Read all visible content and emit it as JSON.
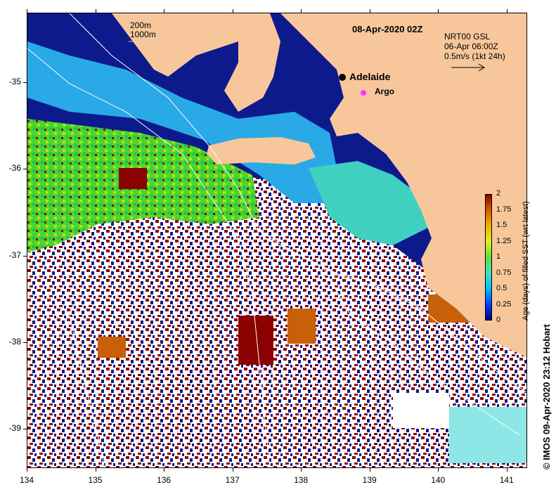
{
  "map": {
    "title": "08-Apr-2020 02Z",
    "depth_contours": [
      "200m",
      "1000m"
    ],
    "current_info": [
      "NRT00 GSL",
      "06-Apr 06:00Z",
      "0.5m/s (1kt 24h)"
    ],
    "city": "Adelaide",
    "float_label": "Argo",
    "x_ticks": [
      "134",
      "135",
      "136",
      "137",
      "138",
      "139",
      "140",
      "141"
    ],
    "y_ticks": [
      "-35",
      "-36",
      "-37",
      "-38",
      "-39"
    ],
    "credit": "© IMOS 09-Apr-2020 23:12 Hobart",
    "extent": {
      "lon": [
        134,
        141.3
      ],
      "lat": [
        -39.45,
        -34.2
      ]
    },
    "colors": {
      "land": "#f7c79b",
      "deep_navy": "#0c1a8c",
      "cloud": "#ffffff",
      "argo": "#ff33ff"
    }
  },
  "colorbar": {
    "title": "Age (days) of filled SST (wrt latest)",
    "ticks": [
      "2",
      "1.75",
      "1.5",
      "1.25",
      "1",
      "0.75",
      "0.5",
      "0.25",
      "0"
    ],
    "range": [
      0,
      2
    ],
    "stops": [
      "#000080",
      "#0040ff",
      "#00c0ff",
      "#40e0c0",
      "#60e040",
      "#e0f020",
      "#f0b000",
      "#d06000",
      "#8b0000"
    ]
  }
}
